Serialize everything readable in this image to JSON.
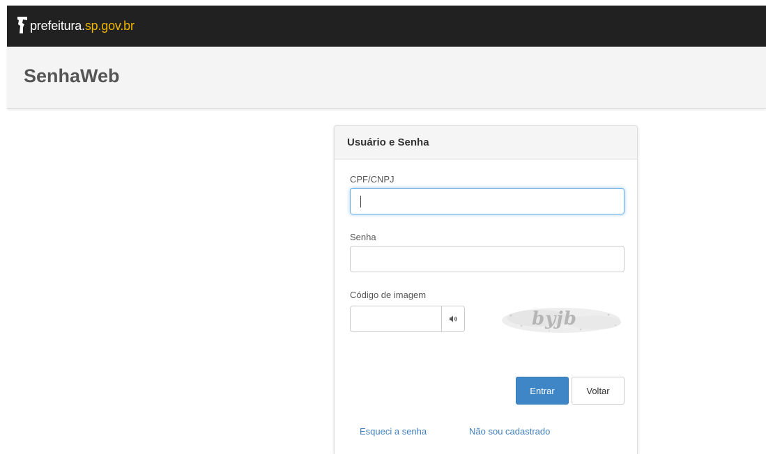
{
  "brand": {
    "logo_icon": "sp-city-logo-icon",
    "name": "prefeitura.",
    "domain": "sp.gov.br",
    "topbar_color": "#212121",
    "domain_color": "#f0b400"
  },
  "header": {
    "title": "SenhaWeb"
  },
  "login_panel": {
    "heading": "Usuário e Senha",
    "cpf_label": "CPF/CNPJ",
    "cpf_value": "",
    "password_label": "Senha",
    "password_value": "",
    "captcha_label": "Código de imagem",
    "captcha_value": "",
    "audio_icon": "speaker-icon",
    "captcha_text": "byjb",
    "submit_label": "Entrar",
    "back_label": "Voltar",
    "forgot_link": "Esqueci a senha",
    "register_link": "Não sou cadastrado",
    "accent_color": "#3f86c6"
  }
}
